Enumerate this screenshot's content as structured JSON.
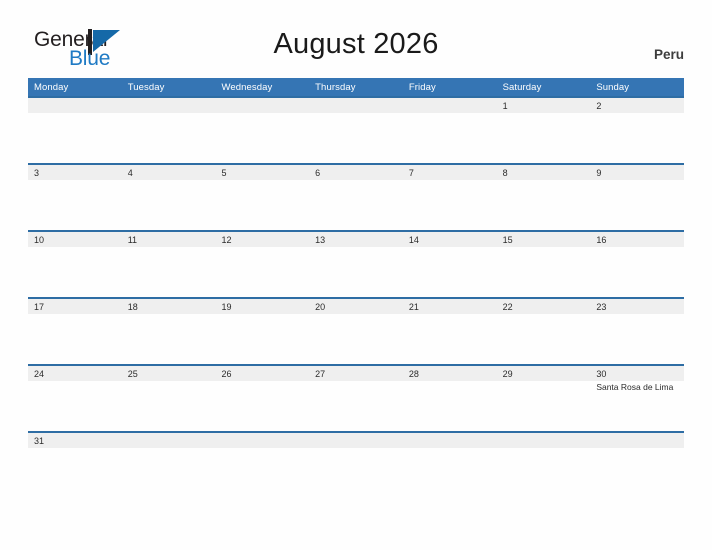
{
  "brand": {
    "name_part1": "General",
    "name_part2": "Blue",
    "mark_icon": "flag-triangle-icon"
  },
  "header": {
    "title": "August 2026",
    "region": "Peru"
  },
  "calendar": {
    "weekday_headers": [
      "Monday",
      "Tuesday",
      "Wednesday",
      "Thursday",
      "Friday",
      "Saturday",
      "Sunday"
    ],
    "weeks": [
      [
        {
          "date": "",
          "events": []
        },
        {
          "date": "",
          "events": []
        },
        {
          "date": "",
          "events": []
        },
        {
          "date": "",
          "events": []
        },
        {
          "date": "",
          "events": []
        },
        {
          "date": "1",
          "events": []
        },
        {
          "date": "2",
          "events": []
        }
      ],
      [
        {
          "date": "3",
          "events": []
        },
        {
          "date": "4",
          "events": []
        },
        {
          "date": "5",
          "events": []
        },
        {
          "date": "6",
          "events": []
        },
        {
          "date": "7",
          "events": []
        },
        {
          "date": "8",
          "events": []
        },
        {
          "date": "9",
          "events": []
        }
      ],
      [
        {
          "date": "10",
          "events": []
        },
        {
          "date": "11",
          "events": []
        },
        {
          "date": "12",
          "events": []
        },
        {
          "date": "13",
          "events": []
        },
        {
          "date": "14",
          "events": []
        },
        {
          "date": "15",
          "events": []
        },
        {
          "date": "16",
          "events": []
        }
      ],
      [
        {
          "date": "17",
          "events": []
        },
        {
          "date": "18",
          "events": []
        },
        {
          "date": "19",
          "events": []
        },
        {
          "date": "20",
          "events": []
        },
        {
          "date": "21",
          "events": []
        },
        {
          "date": "22",
          "events": []
        },
        {
          "date": "23",
          "events": []
        }
      ],
      [
        {
          "date": "24",
          "events": []
        },
        {
          "date": "25",
          "events": []
        },
        {
          "date": "26",
          "events": []
        },
        {
          "date": "27",
          "events": []
        },
        {
          "date": "28",
          "events": []
        },
        {
          "date": "29",
          "events": []
        },
        {
          "date": "30",
          "events": [
            "Santa Rosa de Lima"
          ]
        }
      ],
      [
        {
          "date": "31",
          "events": []
        },
        {
          "date": "",
          "events": []
        },
        {
          "date": "",
          "events": []
        },
        {
          "date": "",
          "events": []
        },
        {
          "date": "",
          "events": []
        },
        {
          "date": "",
          "events": []
        },
        {
          "date": "",
          "events": []
        }
      ]
    ]
  },
  "colors": {
    "header_blue": "#3575b4",
    "rule_blue": "#2e6da4",
    "date_band_gray": "#efefef",
    "brand_blue": "#1f7ac4",
    "text_dark": "#2b2b2b"
  }
}
